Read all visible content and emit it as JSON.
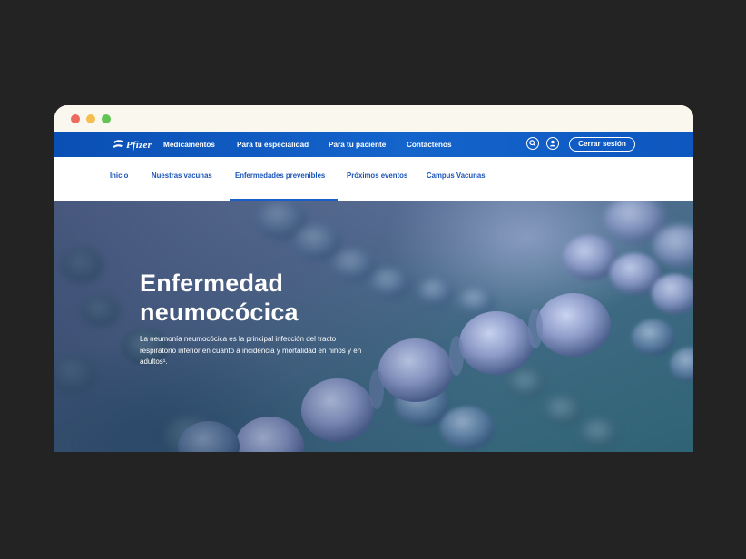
{
  "brand": {
    "logo_text": "Pfizer",
    "primary_color": "#1464cc",
    "background": "#232323"
  },
  "window_controls": [
    "close",
    "minimize",
    "maximize"
  ],
  "topnav": {
    "items": [
      "Medicamentos",
      "Para tu especialidad",
      "Para tu paciente",
      "Contáctenos"
    ],
    "search_icon": "search-icon",
    "user_icon": "user-icon",
    "session_button": "Cerrar sesión"
  },
  "subnav": {
    "items": [
      "Inicio",
      "Nuestras vacunas",
      "Enfermedades prevenibles",
      "Próximos eventos",
      "Campus Vacunas"
    ],
    "active": "Enfermedades prevenibles"
  },
  "hero": {
    "title_line1": "Enfermedad",
    "title_line2": "neumocócica",
    "description": "La neumonía neumocócica es la principal infección del tracto respiratorio inferior en cuanto a incidencia y mortalidad en niños y en adultos¹."
  }
}
